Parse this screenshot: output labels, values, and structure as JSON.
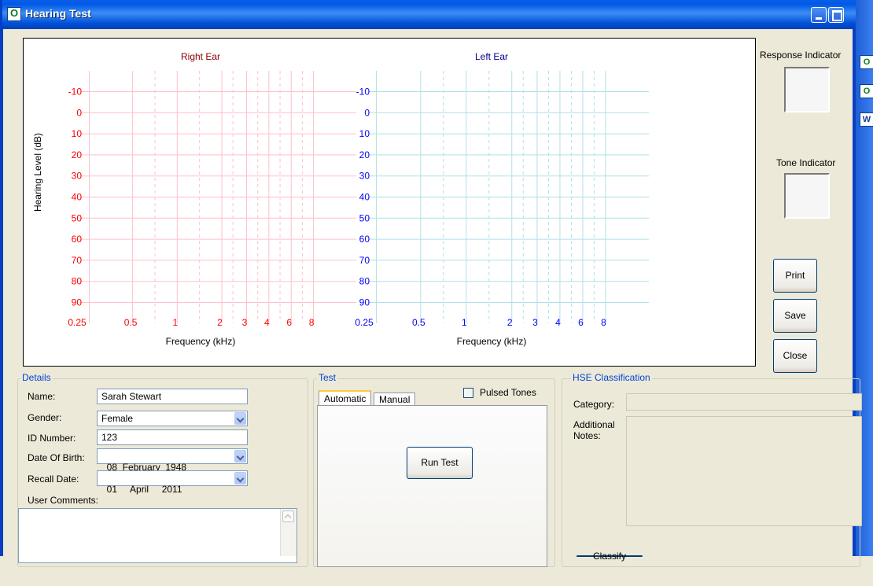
{
  "window": {
    "title": "Hearing Test"
  },
  "app_icon_glyph": "O",
  "chart_data": [
    {
      "type": "line",
      "title": "Right Ear",
      "xlabel": "Frequency (kHz)",
      "ylabel": "Hearing Level (dB)",
      "x_ticks": [
        "0.25",
        "0.5",
        "1",
        "2",
        "3",
        "4",
        "6",
        "8"
      ],
      "y_ticks": [
        "-10",
        "0",
        "10",
        "20",
        "30",
        "40",
        "50",
        "60",
        "70",
        "80",
        "90"
      ],
      "ylim": [
        -10,
        90
      ],
      "series": [],
      "grid": true,
      "color": "#ff0000",
      "grid_color": "#ffc0cb"
    },
    {
      "type": "line",
      "title": "Left Ear",
      "xlabel": "Frequency (kHz)",
      "ylabel": "",
      "x_ticks": [
        "0.25",
        "0.5",
        "1",
        "2",
        "3",
        "4",
        "6",
        "8"
      ],
      "y_ticks": [
        "-10",
        "0",
        "10",
        "20",
        "30",
        "40",
        "50",
        "60",
        "70",
        "80",
        "90"
      ],
      "ylim": [
        -10,
        90
      ],
      "series": [],
      "grid": true,
      "color": "#0000ff",
      "grid_color": "#b0e0e8"
    }
  ],
  "indicators": {
    "response_label": "Response Indicator",
    "tone_label": "Tone Indicator"
  },
  "buttons": {
    "print": "Print",
    "save": "Save",
    "close": "Close"
  },
  "details": {
    "title": "Details",
    "name_label": "Name:",
    "name_value": "Sarah Stewart",
    "gender_label": "Gender:",
    "gender_value": "Female",
    "id_label": "ID Number:",
    "id_value": "123",
    "dob_label": "Date Of Birth:",
    "dob_value": "08  February  1948",
    "recall_label": "Recall Date:",
    "recall_value": "01     April     2011",
    "comments_label": "User Comments:",
    "comments_value": ""
  },
  "test": {
    "title": "Test",
    "tabs": [
      "Automatic",
      "Manual"
    ],
    "pulsed_label": "Pulsed Tones",
    "pulsed_checked": false,
    "run_label": "Run Test"
  },
  "hse": {
    "title": "HSE Classification",
    "category_label": "Category:",
    "notes_label": "Additional Notes:",
    "classify_label": "Classify"
  }
}
